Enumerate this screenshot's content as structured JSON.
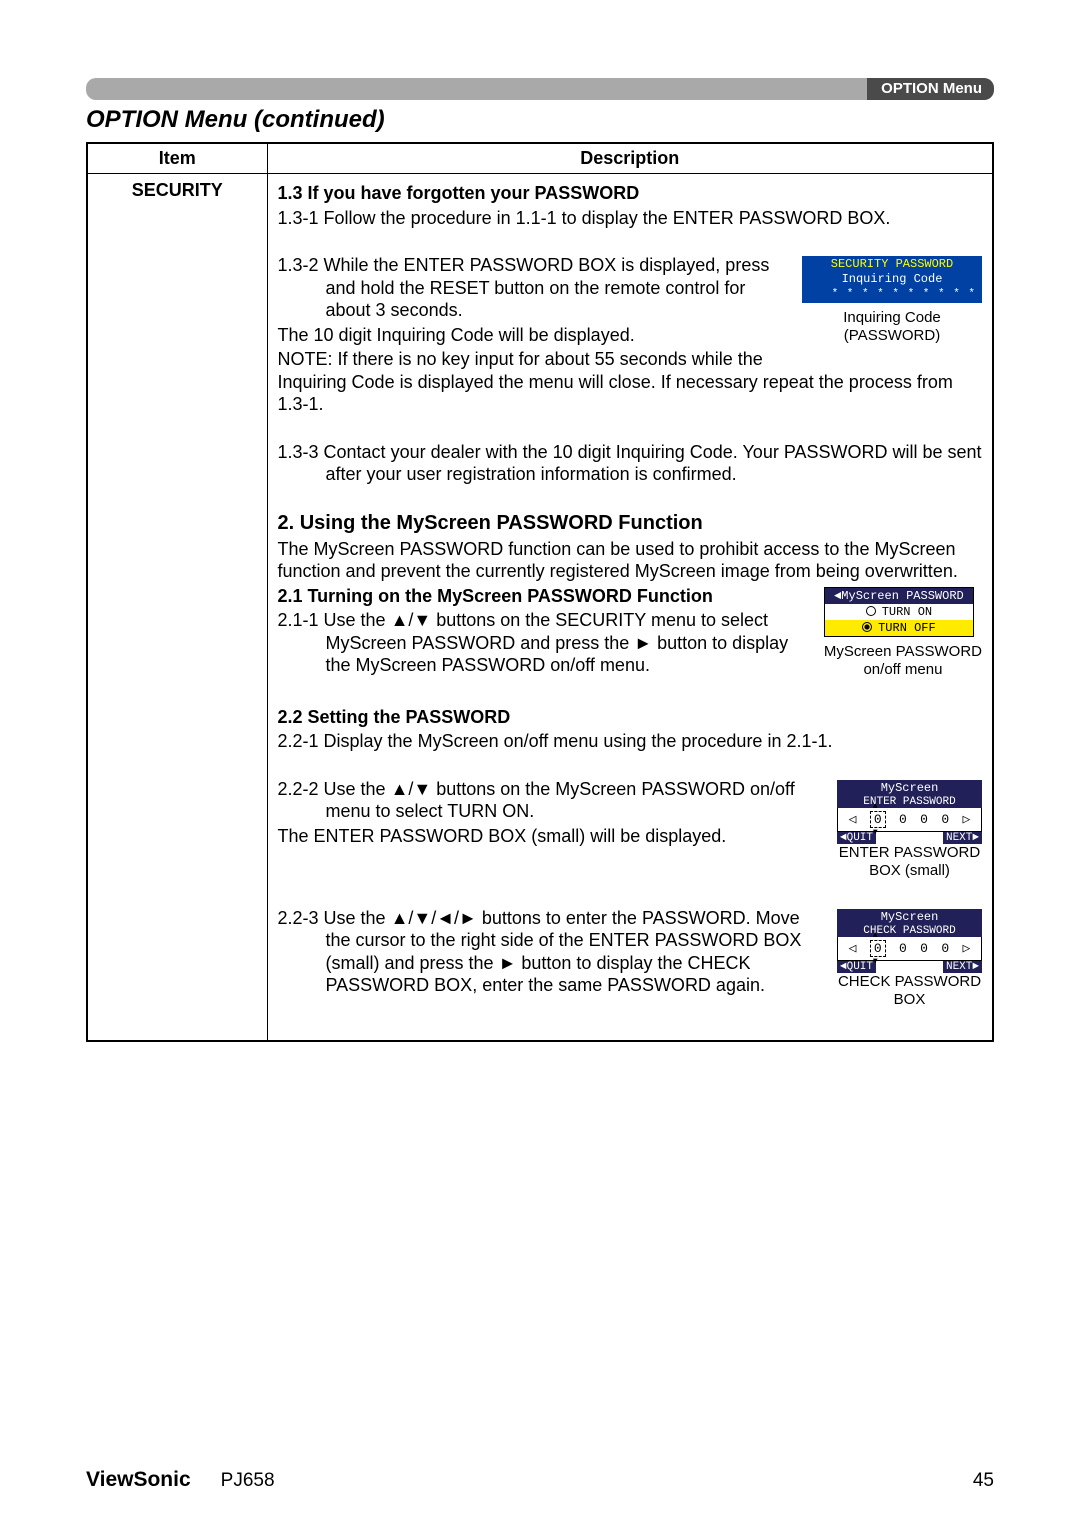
{
  "header": {
    "tab": "OPTION Menu"
  },
  "section_title": "OPTION Menu (continued)",
  "table": {
    "headers": {
      "item": "Item",
      "description": "Description"
    },
    "row": {
      "item": "SECURITY",
      "s13_title": "1.3 If you have forgotten your PASSWORD",
      "s131": "1.3-1 Follow the procedure in 1.1-1 to display the ENTER PASSWORD BOX.",
      "s132a": "1.3-2 While the ENTER PASSWORD BOX is displayed, press and hold the RESET button on the remote control for about 3 seconds.",
      "s132b": "The 10 digit Inquiring Code will be displayed.",
      "s132c": "NOTE: If there is no key input for about 55 seconds while the Inquiring Code is displayed the menu will close. If necessary repeat the process from 1.3-1.",
      "s133": "1.3-3 Contact your dealer with the 10 digit Inquiring Code. Your PASSWORD will be sent after your user registration information is confirmed.",
      "s2_title": "2. Using the MyScreen PASSWORD Function",
      "s2_body": "The MyScreen PASSWORD function can be used to prohibit access to the MyScreen function and prevent the currently registered MyScreen image from being overwritten.",
      "s21_title": "2.1 Turning on the MyScreen PASSWORD Function",
      "s211": "2.1-1 Use the ▲/▼ buttons on the SECURITY menu to select MyScreen PASSWORD and press the ► button to display the MyScreen PASSWORD on/off menu.",
      "s22_title": "2.2 Setting the PASSWORD",
      "s221": "2.2-1 Display the MyScreen on/off menu using the procedure in 2.1-1.",
      "s222a": "2.2-2 Use the ▲/▼ buttons on the MyScreen PASSWORD on/off menu to select TURN ON.",
      "s222b": "The ENTER PASSWORD BOX (small) will be displayed.",
      "s223": "2.2-3 Use the ▲/▼/◄/► buttons to enter the PASSWORD. Move the cursor to the right side of the ENTER PASSWORD BOX (small) and press the ► button to display the CHECK PASSWORD BOX, enter the same PASSWORD again."
    }
  },
  "ic": {
    "title": "SECURITY PASSWORD",
    "sub": "Inquiring Code",
    "stars": "* *  * * * *  * * * *",
    "caption1": "Inquiring Code",
    "caption2": "(PASSWORD)"
  },
  "ms": {
    "title": "◄MyScreen PASSWORD",
    "opt1": "TURN ON",
    "opt2": "TURN OFF",
    "caption1": "MyScreen PASSWORD",
    "caption2": "on/off menu"
  },
  "pw_enter": {
    "t1": "MyScreen",
    "t2": "ENTER PASSWORD",
    "d": [
      "0",
      "0",
      "0",
      "0"
    ],
    "q": "◄QUIT",
    "n": "NEXT►",
    "cap1": "ENTER PASSWORD",
    "cap2": "BOX (small)"
  },
  "pw_check": {
    "t1": "MyScreen",
    "t2": "CHECK PASSWORD",
    "d": [
      "0",
      "0",
      "0",
      "0"
    ],
    "q": "◄QUIT",
    "n": "NEXT►",
    "cap1": "CHECK PASSWORD",
    "cap2": "BOX"
  },
  "footer": {
    "brand": "ViewSonic",
    "model": "PJ658",
    "page": "45"
  }
}
